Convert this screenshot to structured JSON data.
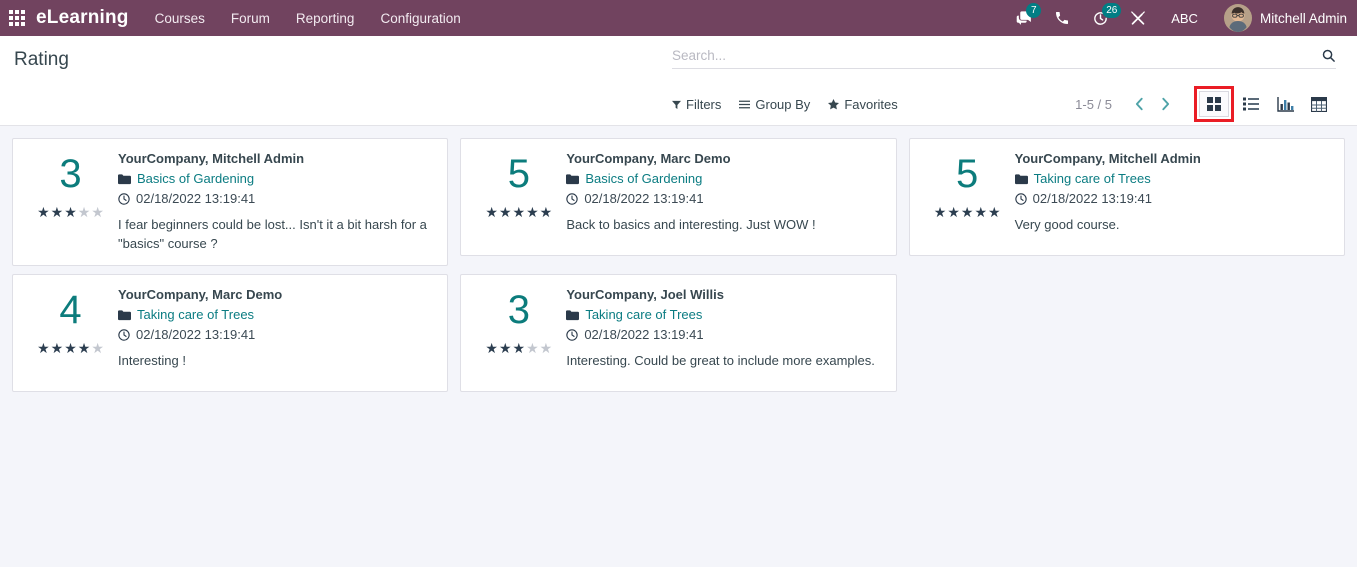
{
  "navbar": {
    "apps_icon": "apps-grid-icon",
    "brand": "eLearning",
    "menu": [
      {
        "label": "Courses"
      },
      {
        "label": "Forum"
      },
      {
        "label": "Reporting"
      },
      {
        "label": "Configuration"
      }
    ],
    "systray": {
      "messages_icon": "chat-bubble-icon",
      "messages_count": "7",
      "phone_icon": "phone-icon",
      "activities_icon": "clock-activity-icon",
      "activities_count": "26",
      "tools_icon": "tools-icon",
      "debug_label": "ABC",
      "avatar_icon": "user-avatar",
      "user_name": "Mitchell Admin"
    },
    "background_color": "#71435f",
    "badge_color": "#017e84"
  },
  "control_panel": {
    "title": "Rating",
    "search": {
      "placeholder": "Search...",
      "value": "",
      "icon": "search-icon"
    },
    "filters_label": "Filters",
    "group_by_label": "Group By",
    "favorites_label": "Favorites",
    "pager": "1-5 / 5",
    "prev_icon": "chevron-left-icon",
    "next_icon": "chevron-right-icon",
    "views": [
      {
        "name": "kanban",
        "icon": "kanban-view-icon",
        "active": true,
        "highlighted": true
      },
      {
        "name": "list",
        "icon": "list-view-icon",
        "active": false,
        "highlighted": false
      },
      {
        "name": "graph",
        "icon": "graph-view-icon",
        "active": false,
        "highlighted": false
      },
      {
        "name": "pivot",
        "icon": "pivot-view-icon",
        "active": false,
        "highlighted": false
      }
    ],
    "highlight_color": "#ea1d25"
  },
  "ratings": [
    {
      "score": "3",
      "stars_filled": 3,
      "stars_total": 5,
      "partner": "YourCompany, Mitchell Admin",
      "course": "Basics of Gardening",
      "date": "02/18/2022 13:19:41",
      "feedback": "I fear beginners could be lost... Isn't it a bit harsh for a \"basics\" course ?"
    },
    {
      "score": "5",
      "stars_filled": 5,
      "stars_total": 5,
      "partner": "YourCompany, Marc Demo",
      "course": "Basics of Gardening",
      "date": "02/18/2022 13:19:41",
      "feedback": "Back to basics and interesting. Just WOW !"
    },
    {
      "score": "5",
      "stars_filled": 5,
      "stars_total": 5,
      "partner": "YourCompany, Mitchell Admin",
      "course": "Taking care of Trees",
      "date": "02/18/2022 13:19:41",
      "feedback": "Very good course."
    },
    {
      "score": "4",
      "stars_filled": 4,
      "stars_total": 5,
      "partner": "YourCompany, Marc Demo",
      "course": "Taking care of Trees",
      "date": "02/18/2022 13:19:41",
      "feedback": "Interesting !"
    },
    {
      "score": "3",
      "stars_filled": 3,
      "stars_total": 5,
      "partner": "YourCompany, Joel Willis",
      "course": "Taking care of Trees",
      "date": "02/18/2022 13:19:41",
      "feedback": "Interesting. Could be great to include more examples."
    }
  ],
  "colors": {
    "accent_teal": "#0c7c7c",
    "link_teal": "#0b7c82",
    "content_bg": "#f4f5fa",
    "star_filled": "#2c3e50",
    "star_empty": "#c3c7cf"
  }
}
